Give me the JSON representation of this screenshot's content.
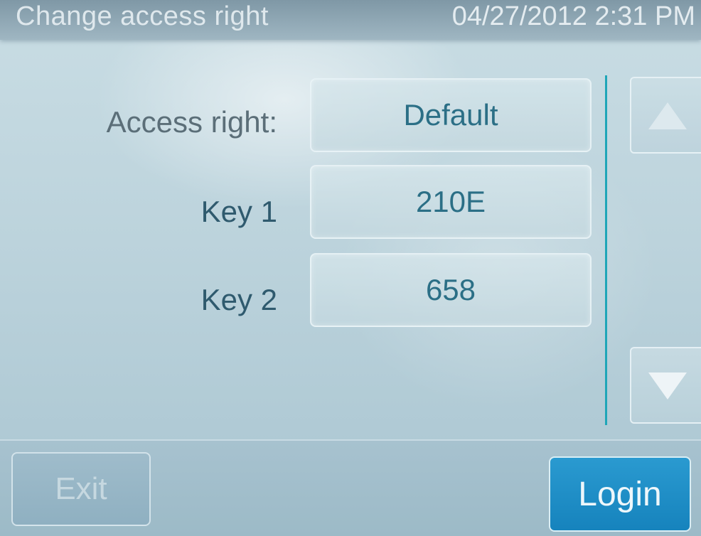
{
  "header": {
    "title": "Change access right",
    "datetime": "04/27/2012 2:31 PM"
  },
  "form": {
    "rows": [
      {
        "label": "Access right:",
        "value": "Default"
      },
      {
        "label": "Key 1",
        "value": "210E"
      },
      {
        "label": "Key 2",
        "value": "658"
      }
    ]
  },
  "scroll": {
    "up_icon": "triangle-up-icon",
    "down_icon": "triangle-down-icon"
  },
  "footer": {
    "exit_label": "Exit",
    "login_label": "Login"
  },
  "colors": {
    "accent": "#1683bd",
    "divider": "#1fa6b8",
    "value_text": "#2b6f86"
  }
}
